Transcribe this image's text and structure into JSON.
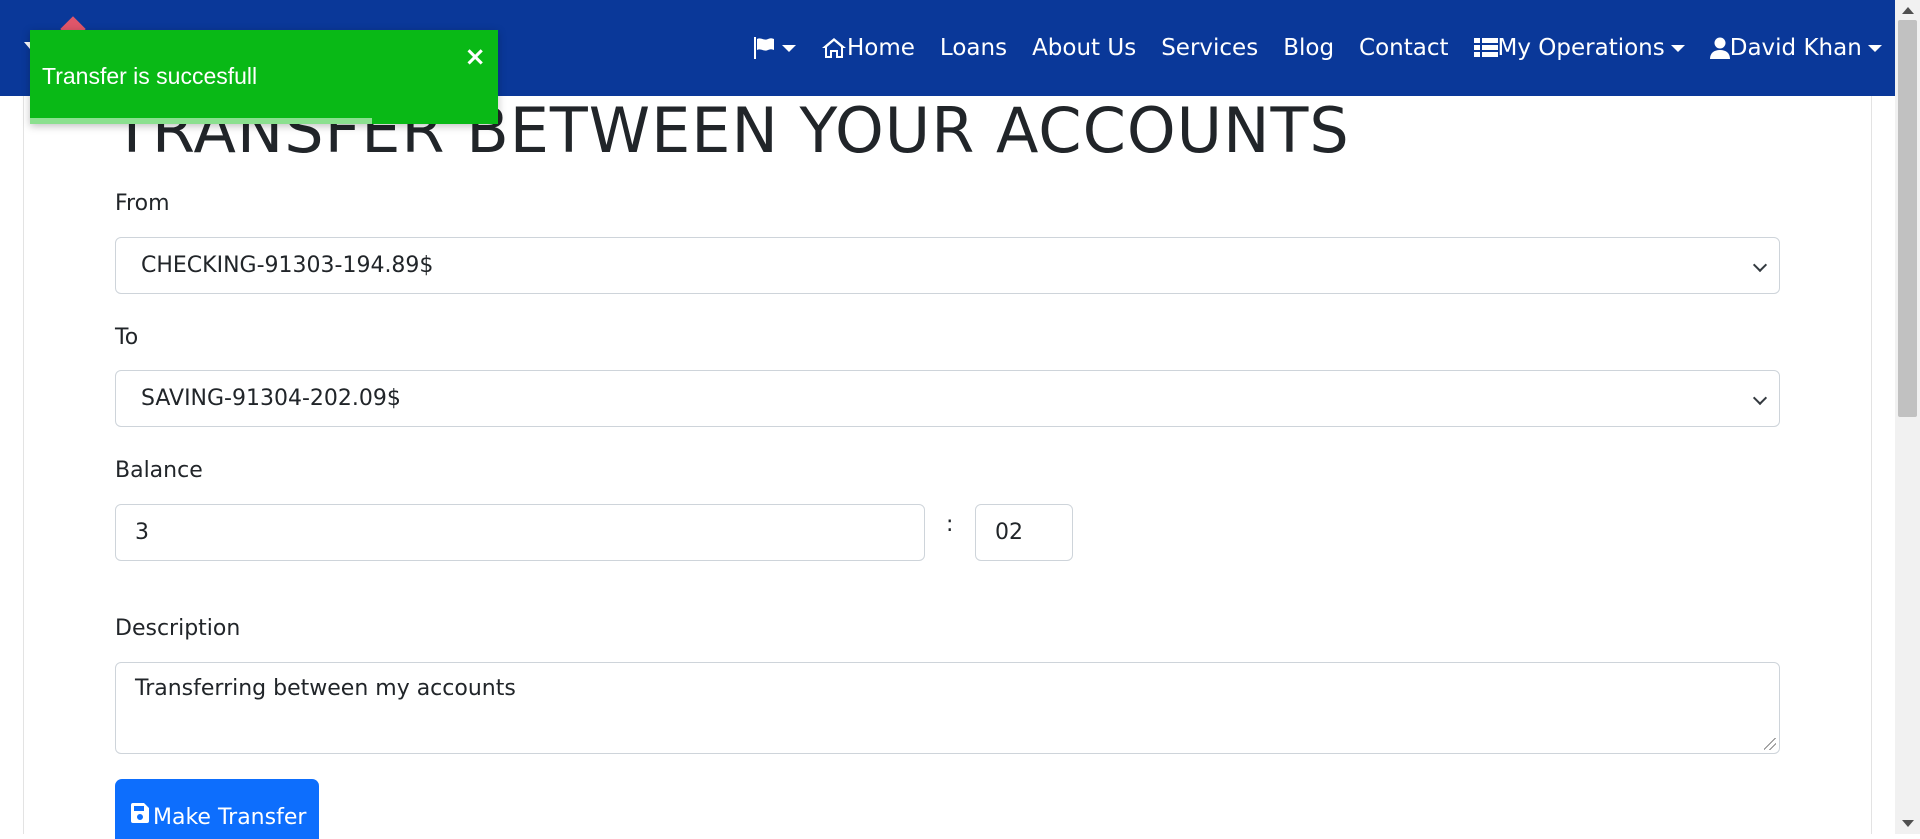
{
  "navbar": {
    "items": [
      {
        "label": "",
        "icon": "flag-icon",
        "dropdown": true
      },
      {
        "label": "Home",
        "icon": "home-icon"
      },
      {
        "label": "Loans"
      },
      {
        "label": "About Us"
      },
      {
        "label": "Services"
      },
      {
        "label": "Blog"
      },
      {
        "label": "Contact"
      },
      {
        "label": "My Operations",
        "icon": "list-icon",
        "dropdown": true
      },
      {
        "label": "David Khan",
        "icon": "user-icon",
        "dropdown": true
      }
    ],
    "background": "#0a3899"
  },
  "page": {
    "title": "TRANSFER BETWEEN YOUR ACCOUNTS"
  },
  "form": {
    "from_label": "From",
    "from_value": "CHECKING-91303-194.89$",
    "to_label": "To",
    "to_value": "SAVING-91304-202.09$",
    "balance_label": "Balance",
    "balance_whole": "3",
    "balance_separator": ":",
    "balance_cents": "02",
    "description_label": "Description",
    "description_value": "Transferring between my accounts",
    "submit_label": "Make Transfer",
    "submit_icon": "save-icon",
    "accent": "#0d6efd"
  },
  "toast": {
    "message": "Transfer is succesfull",
    "close": "×",
    "color": "#09b916",
    "progress": 0.73
  }
}
